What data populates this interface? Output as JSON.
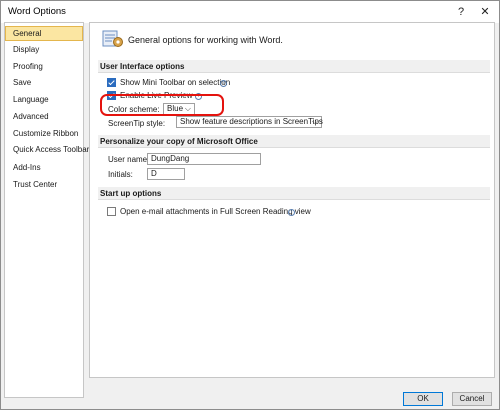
{
  "window": {
    "title": "Word Options",
    "help_glyph": "?",
    "close_glyph": "✕"
  },
  "sidebar": {
    "items": [
      {
        "label": "General",
        "selected": true
      },
      {
        "label": "Display"
      },
      {
        "label": "Proofing"
      },
      {
        "label": "Save"
      },
      {
        "label": "Language"
      },
      {
        "label": "Advanced"
      },
      {
        "label": "Customize Ribbon"
      },
      {
        "label": "Quick Access Toolbar"
      },
      {
        "label": "Add-Ins"
      },
      {
        "label": "Trust Center"
      }
    ]
  },
  "main": {
    "title": "General options for working with Word.",
    "header_icon": "options-gear-icon",
    "sections": {
      "ui": {
        "title": "User Interface options",
        "mini_toolbar_label": "Show Mini Toolbar on selection",
        "mini_toolbar_checked": true,
        "live_preview_label": "Enable Live Preview",
        "live_preview_checked": true,
        "color_scheme_label": "Color scheme:",
        "color_scheme_value": "Blue",
        "screentip_label": "ScreenTip style:",
        "screentip_value": "Show feature descriptions in ScreenTips"
      },
      "personalize": {
        "title": "Personalize your copy of Microsoft Office",
        "username_label": "User name:",
        "username_value": "DungDang",
        "initials_label": "Initials:",
        "initials_value": "D"
      },
      "startup": {
        "title": "Start up options",
        "fullscreen_label": "Open e-mail attachments in Full Screen Reading view",
        "fullscreen_checked": false
      }
    }
  },
  "footer": {
    "ok_label": "OK",
    "cancel_label": "Cancel"
  },
  "colors": {
    "selected_bg": "#fbe6a2",
    "selected_border": "#e4b64d",
    "highlight_ring": "#e4130e",
    "checkbox_checked": "#2b6cbf"
  }
}
